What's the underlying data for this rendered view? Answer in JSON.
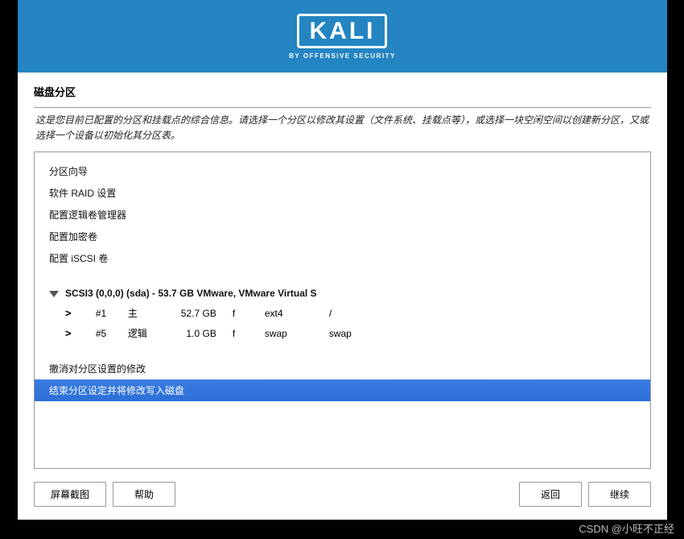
{
  "brand": {
    "name": "KALI",
    "tagline": "BY OFFENSIVE SECURITY"
  },
  "title": "磁盘分区",
  "description": "这是您目前已配置的分区和挂载点的综合信息。请选择一个分区以修改其设置（文件系统、挂载点等），或选择一块空闲空间以创建新分区，又或选择一个设备以初始化其分区表。",
  "menu": {
    "guided": "分区向导",
    "raid": "软件 RAID 设置",
    "lvm": "配置逻辑卷管理器",
    "encrypt": "配置加密卷",
    "iscsi": "配置 iSCSI 卷"
  },
  "disk": {
    "header": "SCSI3 (0,0,0) (sda) - 53.7 GB VMware, VMware Virtual S",
    "partitions": [
      {
        "num": "#1",
        "ptype": "主",
        "size": "52.7 GB",
        "flag": "f",
        "fs": "ext4",
        "mount": "/"
      },
      {
        "num": "#5",
        "ptype": "逻辑",
        "size": "1.0 GB",
        "flag": "f",
        "fs": "swap",
        "mount": "swap"
      }
    ]
  },
  "actions": {
    "undo": "撤消对分区设置的修改",
    "finish": "结束分区设定并将修改写入磁盘"
  },
  "buttons": {
    "screenshot": "屏幕截图",
    "help": "帮助",
    "back": "返回",
    "continue": "继续"
  },
  "watermark": "CSDN @小旺不正经"
}
